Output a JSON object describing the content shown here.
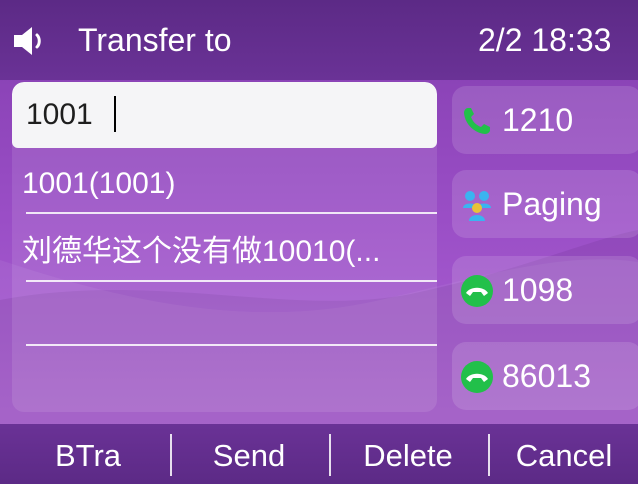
{
  "header": {
    "speaker_icon": "speaker-icon",
    "title": "Transfer to",
    "datetime": "2/2 18:33"
  },
  "search": {
    "value": "1001"
  },
  "results": [
    {
      "label": "1001(1001)"
    },
    {
      "label": "刘德华这个没有做10010(..."
    },
    {
      "label": ""
    },
    {
      "label": ""
    }
  ],
  "line_keys": [
    {
      "label": "1210",
      "icon": "phone-icon",
      "icon_color": "#22c04a"
    },
    {
      "label": "Paging",
      "icon": "paging-group-icon",
      "icon_color": "#3ab4f0"
    },
    {
      "label": "1098",
      "icon": "line-status-icon",
      "icon_color": "#22c04a"
    },
    {
      "label": "86013",
      "icon": "line-status-icon",
      "icon_color": "#22c04a"
    }
  ],
  "softkeys": [
    {
      "label": "BTra"
    },
    {
      "label": "Send"
    },
    {
      "label": "Delete"
    },
    {
      "label": "Cancel"
    }
  ]
}
